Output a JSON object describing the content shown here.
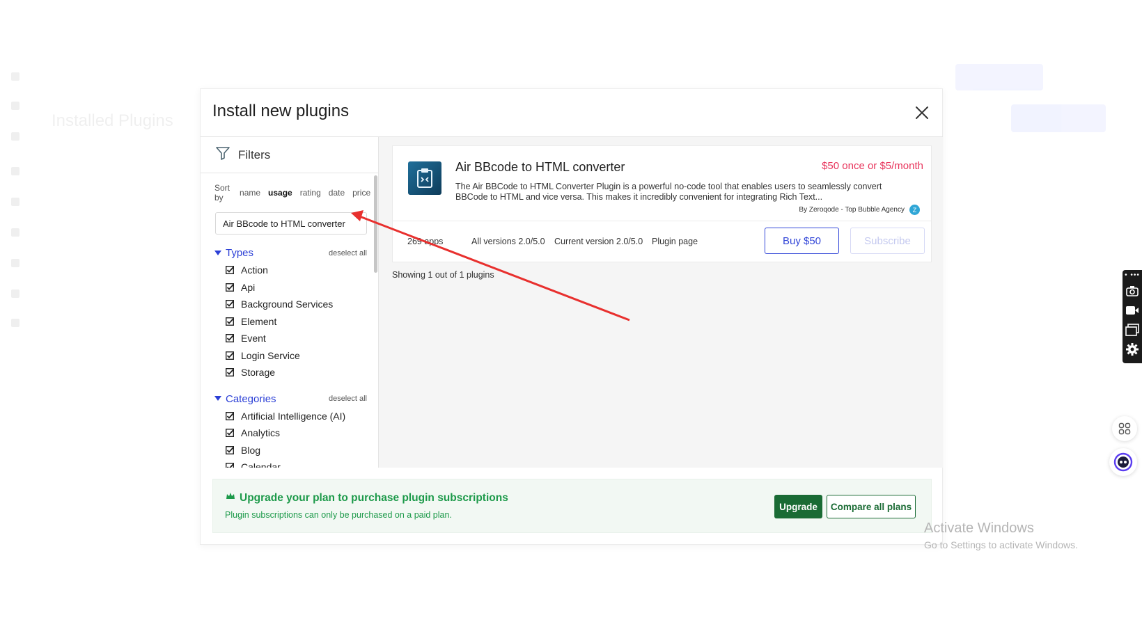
{
  "background": {
    "page_title": "Installed Plugins"
  },
  "modal": {
    "title": "Install new plugins",
    "filters_label": "Filters",
    "sort": {
      "label": "Sort by",
      "options": [
        "name",
        "usage",
        "rating",
        "date",
        "price"
      ],
      "active": "usage"
    },
    "search_value": "Air BBcode to HTML converter",
    "types": {
      "label": "Types",
      "deselect_label": "deselect all",
      "items": [
        "Action",
        "Api",
        "Background Services",
        "Element",
        "Event",
        "Login Service",
        "Storage"
      ]
    },
    "categories": {
      "label": "Categories",
      "deselect_label": "deselect all",
      "items": [
        "Artificial Intelligence (AI)",
        "Analytics",
        "Blog",
        "Calendar"
      ]
    },
    "plugin": {
      "name": "Air BBcode to HTML converter",
      "price": "$50 once or $5/month",
      "description": "The Air BBCode to HTML Converter Plugin is a powerful no-code tool that enables users to seamlessly convert BBCode to HTML and vice versa. This makes it incredibly convenient for integrating Rich Text...",
      "author": "By Zeroqode - Top Bubble Agency",
      "apps": "269 apps",
      "all_versions": "All versions 2.0/5.0",
      "current_version": "Current version 2.0/5.0",
      "plugin_page": "Plugin page",
      "buy_label": "Buy $50",
      "subscribe_label": "Subscribe"
    },
    "showing": "Showing 1 out of 1 plugins",
    "upgrade": {
      "title": "Upgrade your plan to purchase plugin subscriptions",
      "subtitle": "Plugin subscriptions can only be purchased on a paid plan.",
      "upgrade_label": "Upgrade",
      "compare_label": "Compare all plans"
    }
  },
  "watermark": {
    "line1": "Activate Windows",
    "line2": "Go to Settings to activate Windows."
  },
  "colors": {
    "accent_blue": "#3347d8",
    "price_red": "#e8365d",
    "upgrade_green": "#1a6b34",
    "annotation_arrow": "#e8302e"
  }
}
